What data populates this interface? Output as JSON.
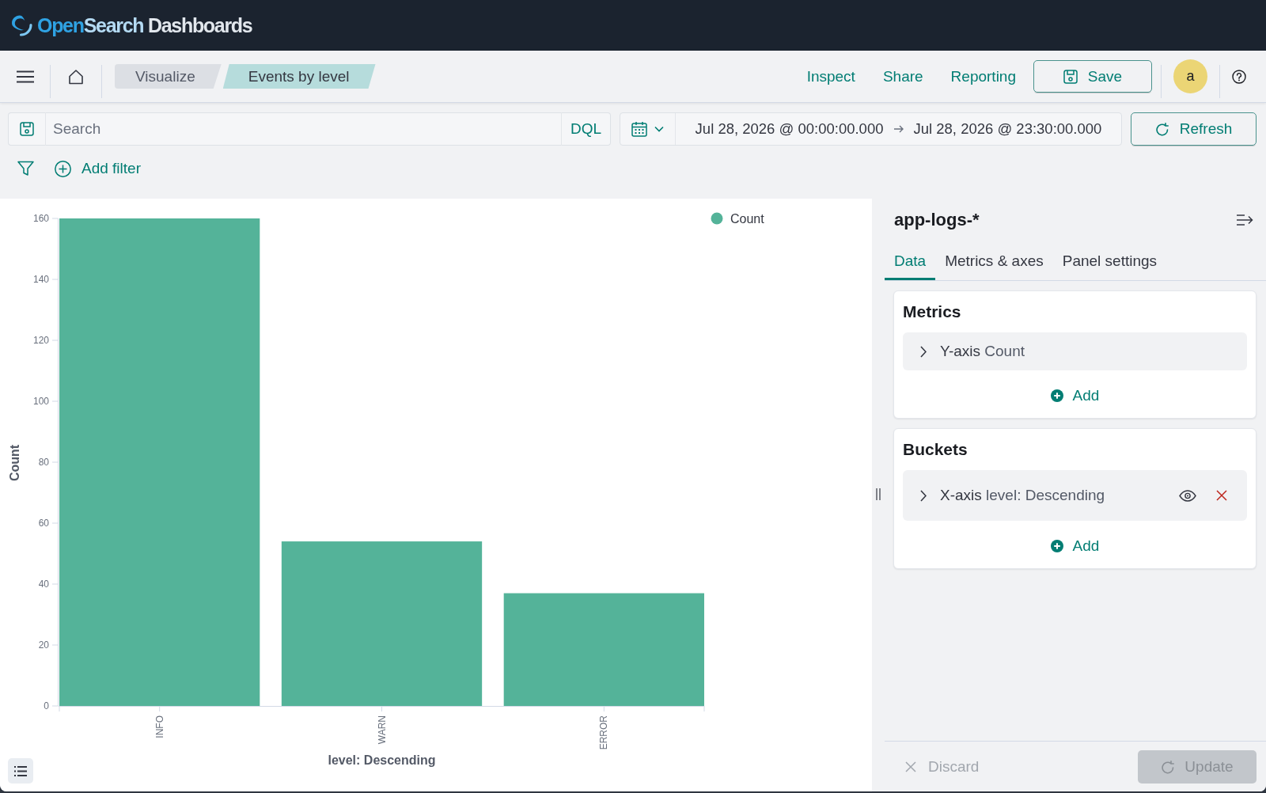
{
  "header": {
    "logo": {
      "name": [
        "Open",
        "Search"
      ],
      "product": "Dashboards"
    }
  },
  "nav": {
    "breadcrumbs": [
      {
        "label": "Visualize",
        "selected": false
      },
      {
        "label": "Events by level",
        "selected": true
      }
    ],
    "links": [
      "Inspect",
      "Share",
      "Reporting"
    ],
    "save_button": "Save",
    "avatar": "a"
  },
  "query_bar": {
    "search": {
      "placeholder": "Search"
    },
    "language": "DQL",
    "time_range": {
      "start": "Jul 28, 2026 @ 00:00:00.000",
      "end": "Jul 28, 2026 @ 23:30:00.000"
    },
    "refresh_button": "Refresh"
  },
  "filter_bar": {
    "add_filter": "Add filter"
  },
  "visualization": {
    "chart_data": {
      "type": "bar",
      "xlabel": "level: Descending",
      "ylabel": "Count",
      "categories": [
        "INFO",
        "WARN",
        "ERROR"
      ],
      "series": [
        {
          "name": "Count",
          "color": "#54b399",
          "values": [
            160,
            54,
            37
          ]
        }
      ],
      "ylim": [
        0,
        160
      ],
      "yticks": [
        0,
        20,
        40,
        60,
        80,
        100,
        120,
        140,
        160
      ]
    }
  },
  "editor": {
    "index_pattern": "app-logs-*",
    "tabs": [
      {
        "label": "Data",
        "selected": true
      },
      {
        "label": "Metrics & axes",
        "selected": false
      },
      {
        "label": "Panel settings",
        "selected": false
      }
    ],
    "sections": [
      {
        "title": "Metrics",
        "aggregations": [
          {
            "axis": "Y-axis",
            "description": "Count",
            "expanded": false,
            "removable": false
          }
        ],
        "add_button": "Add"
      },
      {
        "title": "Buckets",
        "aggregations": [
          {
            "axis": "X-axis",
            "description": "level: Descending",
            "expanded": false,
            "removable": true
          }
        ],
        "add_button": "Add"
      }
    ],
    "discard_button": {
      "label": "Discard",
      "disabled": true
    },
    "update_button": {
      "label": "Update",
      "disabled": true
    }
  }
}
